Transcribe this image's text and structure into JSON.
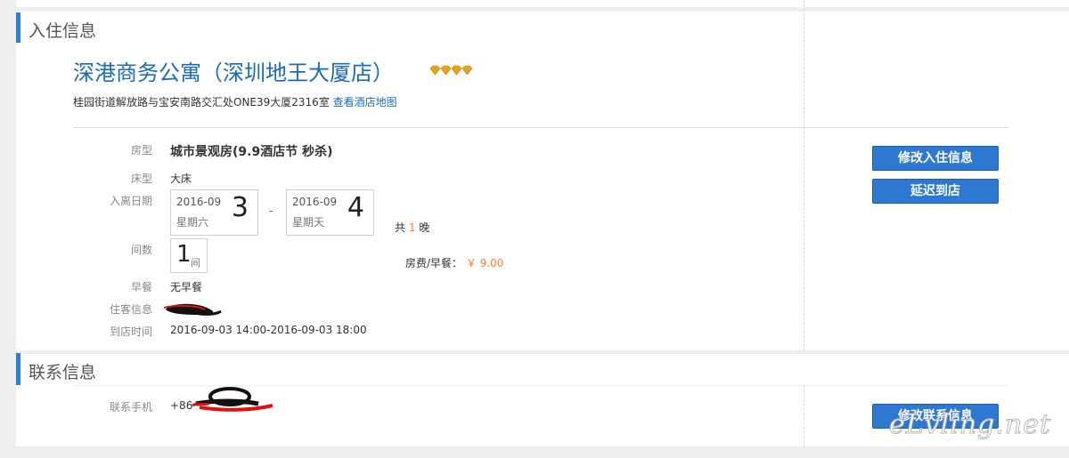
{
  "checkin_section": {
    "title": "入住信息",
    "hotel": {
      "name": "深港商务公寓（深圳地王大厦店）",
      "rating_diamonds": 4,
      "address": "桂园街道解放路与宝安南路交汇处ONE39大厦2316室",
      "map_link": "查看酒店地图"
    },
    "room_type": {
      "label": "房型",
      "value": "城市景观房(9.9酒店节 秒杀)"
    },
    "bed_type": {
      "label": "床型",
      "value": "大床"
    },
    "dates": {
      "label": "入离日期",
      "checkin": {
        "year_month": "2016-09",
        "weekday": "星期六",
        "day": "3"
      },
      "separator": "-",
      "checkout": {
        "year_month": "2016-09",
        "weekday": "星期天",
        "day": "4"
      },
      "nights_prefix": "共",
      "nights": "1",
      "nights_suffix": "晚"
    },
    "rooms": {
      "label": "间数",
      "count": "1",
      "unit": "间"
    },
    "price": {
      "label": "房费/早餐：",
      "currency": "￥",
      "amount": "9.00"
    },
    "breakfast": {
      "label": "早餐",
      "value": "无早餐"
    },
    "guest": {
      "label": "住客信息",
      "value": ""
    },
    "arrival": {
      "label": "到店时间",
      "value": "2016-09-03 14:00-2016-09-03 18:00"
    },
    "buttons": {
      "modify": "修改入住信息",
      "delay": "延迟到店"
    }
  },
  "contact_section": {
    "title": "联系信息",
    "phone": {
      "label": "联系手机",
      "prefix": "+86"
    },
    "button": "修改联系信息"
  },
  "watermark": "eLvling.net",
  "colors": {
    "accent": "#2e78d2",
    "link": "#1a6bbf",
    "price": "#f07f3c",
    "diamond": "#e8a21c"
  }
}
